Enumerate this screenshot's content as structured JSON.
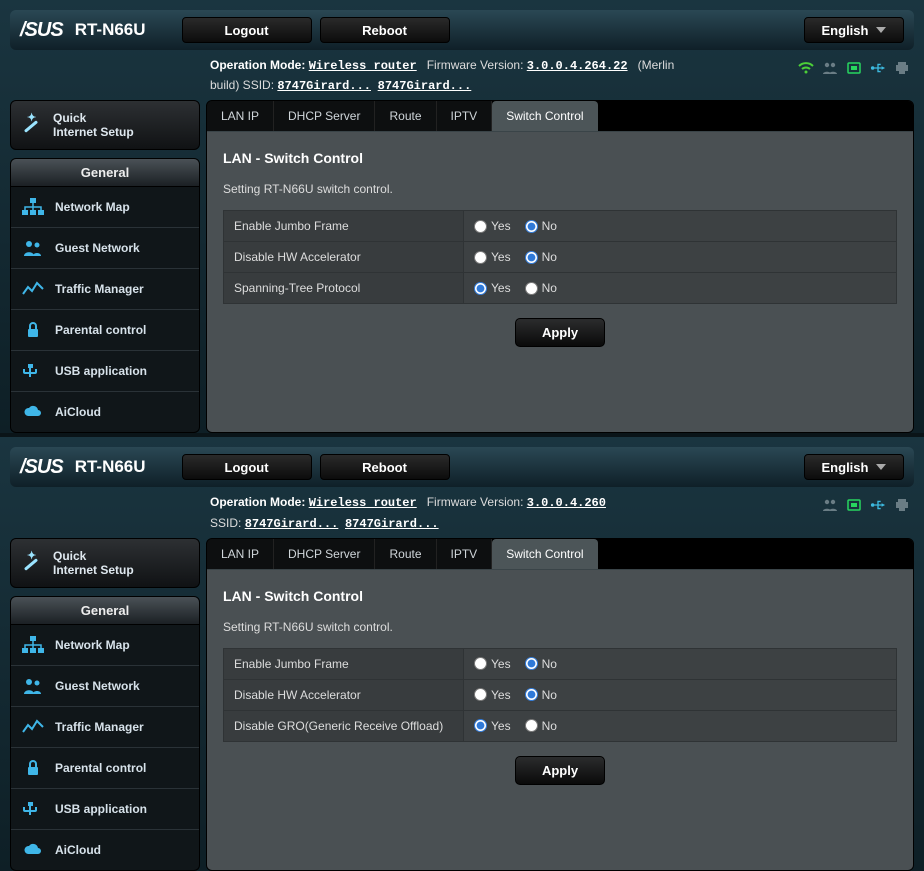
{
  "brand": "/SUS",
  "model": "RT-N66U",
  "buttons": {
    "logout": "Logout",
    "reboot": "Reboot",
    "apply": "Apply"
  },
  "language": "English",
  "labels": {
    "op_mode": "Operation Mode:",
    "fw": "Firmware Version:",
    "ssid": "SSID:",
    "build_suffix": "build)",
    "merlin": "(Merlin",
    "yes": "Yes",
    "no": "No"
  },
  "status_icons": [
    "wifi-icon",
    "users-icon",
    "net-icon",
    "usb-icon",
    "printer-icon"
  ],
  "sidebar": {
    "qis": "Quick Internet Setup",
    "general": "General",
    "items": [
      {
        "label": "Network Map"
      },
      {
        "label": "Guest Network"
      },
      {
        "label": "Traffic Manager"
      },
      {
        "label": "Parental control"
      },
      {
        "label": "USB application"
      },
      {
        "label": "AiCloud"
      }
    ]
  },
  "tabs": [
    "LAN IP",
    "DHCP Server",
    "Route",
    "IPTV",
    "Switch Control"
  ],
  "page": {
    "title": "LAN - Switch Control",
    "desc": "Setting RT-N66U switch control."
  },
  "panels": [
    {
      "op_mode_value": "Wireless router",
      "fw_value": "3.0.0.4.264.22",
      "ssid1": "8747Girard...",
      "ssid2": "8747Girard...",
      "show_wifi": true,
      "show_merlin": true,
      "rows": [
        {
          "key": "Enable Jumbo Frame",
          "selected": "no"
        },
        {
          "key": "Disable HW Accelerator",
          "selected": "no"
        },
        {
          "key": "Spanning-Tree Protocol",
          "selected": "yes"
        }
      ]
    },
    {
      "op_mode_value": "Wireless router",
      "fw_value": "3.0.0.4.260",
      "ssid1": "8747Girard...",
      "ssid2": "8747Girard...",
      "show_wifi": false,
      "show_merlin": false,
      "rows": [
        {
          "key": "Enable Jumbo Frame",
          "selected": "no"
        },
        {
          "key": "Disable HW Accelerator",
          "selected": "no"
        },
        {
          "key": "Disable GRO(Generic Receive Offload)",
          "selected": "yes"
        }
      ]
    }
  ]
}
